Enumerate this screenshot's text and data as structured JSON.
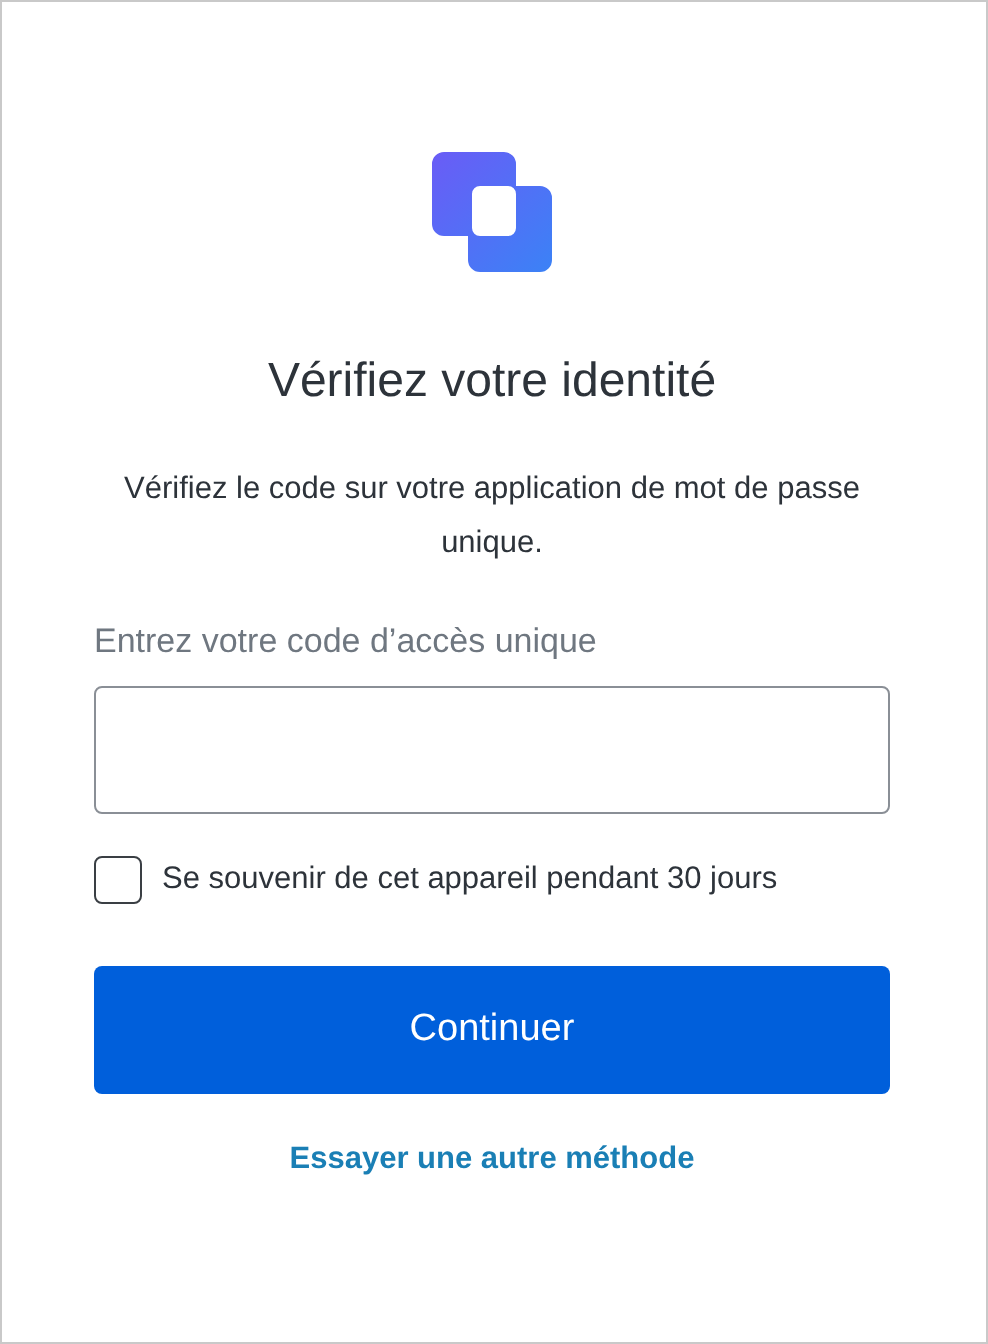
{
  "title": "Vérifiez votre identité",
  "description": "Vérifiez le code sur votre application de mot de passe unique.",
  "code_field": {
    "label": "Entrez votre code d’accès unique"
  },
  "remember": {
    "label": "Se souvenir de cet appareil pendant 30 jours",
    "checked": false
  },
  "primary_button": "Continuer",
  "alternate_link": "Essayer une autre méthode"
}
